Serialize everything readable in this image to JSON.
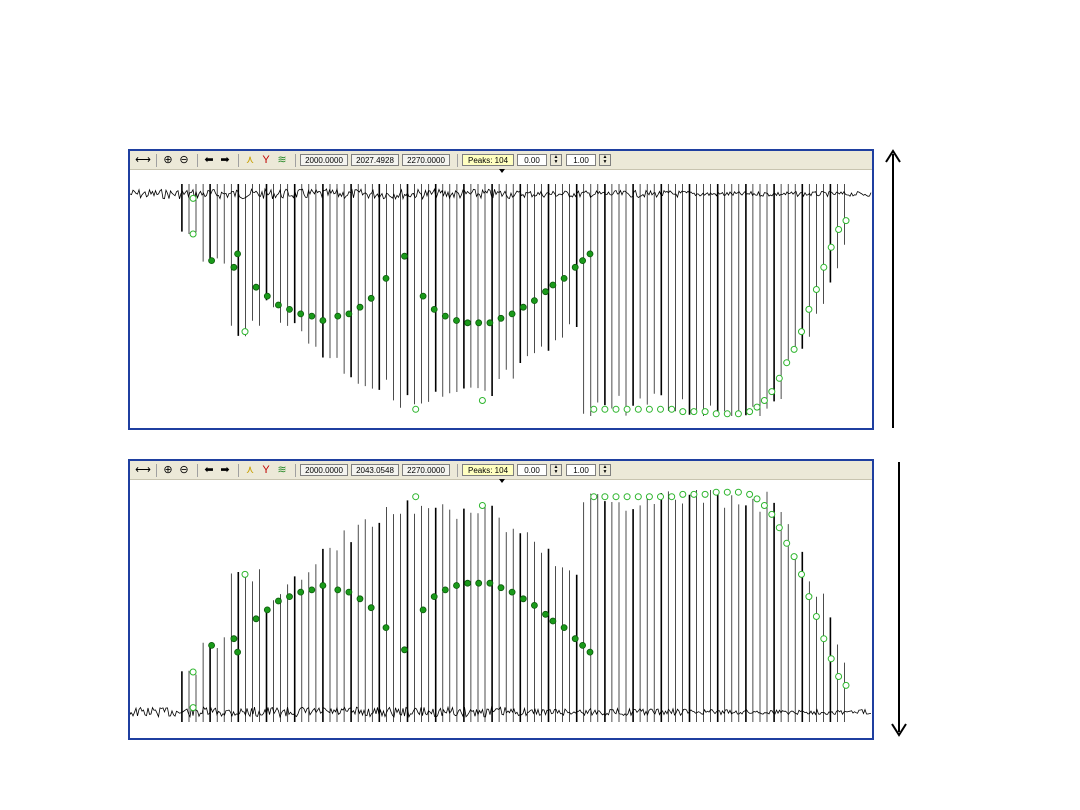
{
  "panels": [
    {
      "id": "top",
      "toolbar": {
        "field_start": "2000.0000",
        "field_cursor": "2027.4928",
        "field_end": "2270.0000",
        "peaks": "Peaks: 104",
        "offset": "0.00",
        "scale": "1.00"
      },
      "orientation": "down"
    },
    {
      "id": "bottom",
      "toolbar": {
        "field_start": "2000.0000",
        "field_cursor": "2043.0548",
        "field_end": "2270.0000",
        "peaks": "Peaks: 104",
        "offset": "0.00",
        "scale": "1.00"
      },
      "orientation": "up"
    }
  ],
  "icons": {
    "fit": "fit-width-icon",
    "zoom_in": "zoom-in-icon",
    "zoom_out": "zoom-out-icon",
    "prev": "arrow-left-icon",
    "next": "arrow-right-icon",
    "peak": "peak-pick-icon",
    "marker": "marker-icon",
    "multi": "multi-peak-icon"
  },
  "colors": {
    "frame": "#1f3fa0",
    "signal": "#000000",
    "fill_marker": "#1a9a1a",
    "hollow_marker": "#2db52d",
    "peaks_field": "#ffffc0"
  },
  "chart_data": {
    "type": "scatter",
    "x_unit": "relative sweep position",
    "y_unit": "relative amplitude",
    "xlim": [
      0,
      1
    ],
    "ylim": [
      0,
      1
    ],
    "series": [
      {
        "kind": "filled",
        "points": [
          [
            0.11,
            0.3
          ],
          [
            0.14,
            0.33
          ],
          [
            0.145,
            0.27
          ],
          [
            0.17,
            0.42
          ],
          [
            0.185,
            0.46
          ],
          [
            0.2,
            0.5
          ],
          [
            0.215,
            0.52
          ],
          [
            0.23,
            0.54
          ],
          [
            0.245,
            0.55
          ],
          [
            0.26,
            0.57
          ],
          [
            0.28,
            0.55
          ],
          [
            0.295,
            0.54
          ],
          [
            0.31,
            0.51
          ],
          [
            0.325,
            0.47
          ],
          [
            0.345,
            0.38
          ],
          [
            0.37,
            0.28
          ],
          [
            0.395,
            0.46
          ],
          [
            0.41,
            0.52
          ],
          [
            0.425,
            0.55
          ],
          [
            0.44,
            0.57
          ],
          [
            0.455,
            0.58
          ],
          [
            0.47,
            0.58
          ],
          [
            0.485,
            0.58
          ],
          [
            0.5,
            0.56
          ],
          [
            0.515,
            0.54
          ],
          [
            0.53,
            0.51
          ],
          [
            0.545,
            0.48
          ],
          [
            0.56,
            0.44
          ],
          [
            0.57,
            0.41
          ],
          [
            0.585,
            0.38
          ],
          [
            0.6,
            0.33
          ],
          [
            0.61,
            0.3
          ],
          [
            0.62,
            0.27
          ]
        ]
      },
      {
        "kind": "hollow",
        "points": [
          [
            0.085,
            0.18
          ],
          [
            0.085,
            0.02
          ],
          [
            0.155,
            0.62
          ],
          [
            0.385,
            0.97
          ],
          [
            0.475,
            0.93
          ],
          [
            0.625,
            0.97
          ],
          [
            0.64,
            0.97
          ],
          [
            0.655,
            0.97
          ],
          [
            0.67,
            0.97
          ],
          [
            0.685,
            0.97
          ],
          [
            0.7,
            0.97
          ],
          [
            0.715,
            0.97
          ],
          [
            0.73,
            0.97
          ],
          [
            0.745,
            0.98
          ],
          [
            0.76,
            0.98
          ],
          [
            0.775,
            0.98
          ],
          [
            0.79,
            0.99
          ],
          [
            0.805,
            0.99
          ],
          [
            0.82,
            0.99
          ],
          [
            0.835,
            0.98
          ],
          [
            0.845,
            0.96
          ],
          [
            0.855,
            0.93
          ],
          [
            0.865,
            0.89
          ],
          [
            0.875,
            0.83
          ],
          [
            0.885,
            0.76
          ],
          [
            0.895,
            0.7
          ],
          [
            0.905,
            0.62
          ],
          [
            0.915,
            0.52
          ],
          [
            0.925,
            0.43
          ],
          [
            0.935,
            0.33
          ],
          [
            0.945,
            0.24
          ],
          [
            0.955,
            0.16
          ],
          [
            0.965,
            0.12
          ]
        ]
      }
    ]
  }
}
